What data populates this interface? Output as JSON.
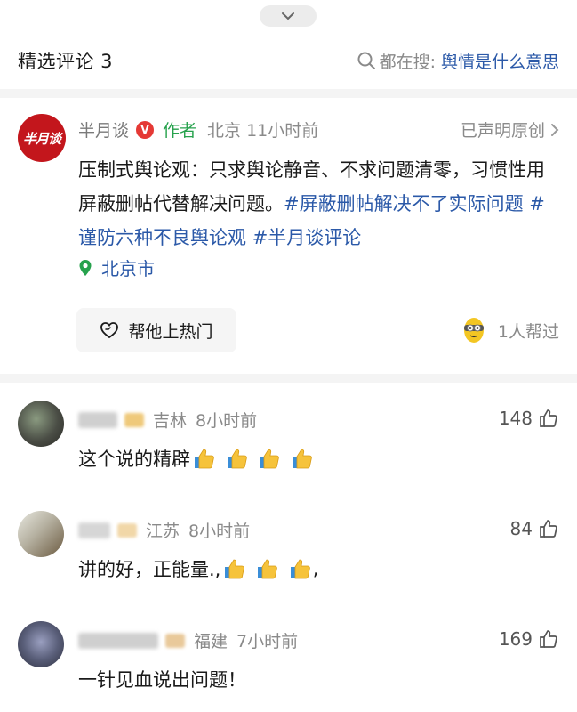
{
  "header": {
    "title": "精选评论 3",
    "search_prefix": "都在搜:",
    "search_query": "舆情是什么意思"
  },
  "author_post": {
    "avatar_text": "半月谈",
    "name": "半月谈",
    "verified_badge": "V",
    "author_tag": "作者",
    "location_time": "北京 11小时前",
    "original_label": "已声明原创",
    "body_text": "压制式舆论观：只求舆论静音、不求问题清零，习惯性用屏蔽删帖代替解决问题。",
    "tags": [
      "#屏蔽删帖解决不了实际问题",
      "#谨防六种不良舆论观",
      "#半月谈评论"
    ],
    "location": "北京市",
    "hot_button": "帮他上热门",
    "helped_text": "1人帮过"
  },
  "comments": [
    {
      "province": "吉林",
      "time": "8小时前",
      "likes": "148",
      "text": "这个说的精辟",
      "emoji_count": 4
    },
    {
      "province": "江苏",
      "time": "8小时前",
      "likes": "84",
      "text": "讲的好，正能量.,",
      "emoji_tail": ",",
      "emoji_count": 3
    },
    {
      "province": "福建",
      "time": "7小时前",
      "likes": "169",
      "text": "一针见血说出问题！",
      "emoji_count": 0
    }
  ],
  "colors": {
    "link_blue": "#2b59a8",
    "author_green": "#27a24d",
    "brand_red": "#c3161c",
    "meta_gray": "#8a8a8a"
  },
  "icons": [
    "chevron-down-icon",
    "search-icon",
    "verified-icon",
    "chevron-right-icon",
    "location-pin-icon",
    "heart-hand-icon",
    "mascot-icon",
    "thumbs-up-icon",
    "thumbs-up-emoji"
  ]
}
